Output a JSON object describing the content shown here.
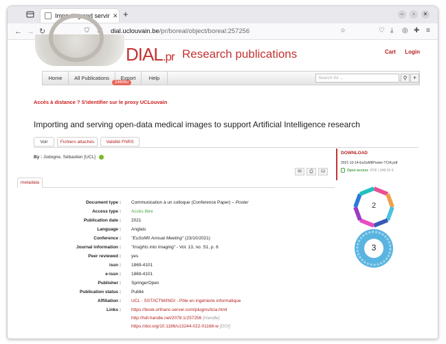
{
  "browser": {
    "tab_title": "Importing and serving op",
    "url_host": "dial.uclouvain.be",
    "url_path": "/pr/boreal/object/boreal:257256"
  },
  "site": {
    "logo_text": "DIAL",
    "logo_suffix": ".pr",
    "subtitle": "Research publications",
    "cart": "Cart",
    "login": "Login"
  },
  "menu": {
    "home": "Home",
    "all_publications": "All Publications",
    "all_publications_count": "246060",
    "export": "Export",
    "help": "Help",
    "search_placeholder": "Search for ..."
  },
  "notice": "Accès à distance ? S'identifier sur le proxy UCLouvain",
  "document": {
    "title": "Importing and serving open-data medical images to support Artificial Intelligence research",
    "tabs": [
      "Voir",
      "Fichiers attachés",
      "Validité FNRS"
    ],
    "authors_label": "By :",
    "authors": "Jodogne, Sébastien",
    "affil_short": "[UCL]",
    "metadata_tab": "metadata"
  },
  "download": {
    "title": "DOWNLOAD",
    "filename": "2021-10-14-EuSoMIIPoster-TCIA.pdf",
    "access": "Open access",
    "format": "PDF",
    "size": "948.09 K"
  },
  "metrics": {
    "altmetric_score": "2",
    "dimensions_score": "3"
  },
  "metadata": {
    "doc_type_label": "Document type :",
    "doc_type": "Communication à un colloque (Conference Paper) –",
    "doc_type_sub": "Poster",
    "access_type_label": "Access type :",
    "access_type": "Accès libre",
    "pub_date_label": "Publication date :",
    "pub_date": "2021",
    "language_label": "Language :",
    "language": "Anglais",
    "conference_label": "Conference :",
    "conference_name": "\"EuSoMII Annual Meeting\"",
    "conference_date": "(23/10/2021)",
    "journal_label": "Journal information :",
    "journal_name": "\"Insights into Imaging\"",
    "journal_details": "- Vol. 13, no. S1, p. 6",
    "peer_label": "Peer reviewed :",
    "peer": "yes",
    "issn_label": "issn :",
    "issn": "1869-4101",
    "eissn_label": "e-issn :",
    "eissn": "1869-4101",
    "publisher_label": "Publisher :",
    "publisher": "SpringerOpen",
    "status_label": "Publication status :",
    "status": "Publié",
    "affiliation_label": "Affiliation :",
    "affiliation": "UCL - SST/ICTM/INGI - Pôle en ingénierie informatique",
    "links_label": "Links :",
    "link1": "https://book.orthanc-server.com/plugins/tcia.html",
    "link2": "http://hdl.handle.net/2078.1/257256",
    "link2_tag": "[Handle]",
    "link3": "https://doi.org/10.1186/s13244-022-01168-w",
    "link3_tag": "[DOI]"
  }
}
